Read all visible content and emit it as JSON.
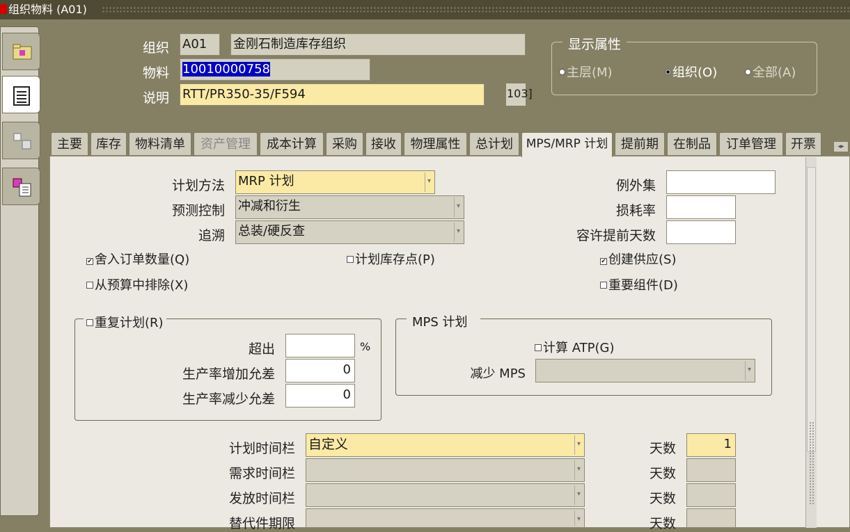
{
  "window": {
    "title": "组织物料 (A01)"
  },
  "header": {
    "org_label": "组织",
    "org_code": "A01",
    "org_name": "金刚石制造库存组织",
    "item_label": "物料",
    "item_value": "10010000758",
    "desc_label": "说明",
    "desc_value": "RTT/PR350-35/F594",
    "desc_extra": "103]"
  },
  "display_attrs": {
    "title": "显示属性",
    "options": [
      {
        "label": "主层(M)",
        "selected": false
      },
      {
        "label": "组织(O)",
        "selected": true
      },
      {
        "label": "全部(A)",
        "selected": false
      }
    ]
  },
  "tabs": [
    {
      "label": "主要",
      "enabled": true
    },
    {
      "label": "库存",
      "enabled": true
    },
    {
      "label": "物料清单",
      "enabled": true
    },
    {
      "label": "资产管理",
      "enabled": false
    },
    {
      "label": "成本计算",
      "enabled": true
    },
    {
      "label": "采购",
      "enabled": true
    },
    {
      "label": "接收",
      "enabled": true
    },
    {
      "label": "物理属性",
      "enabled": true
    },
    {
      "label": "总计划",
      "enabled": true
    },
    {
      "label": "MPS/MRP 计划",
      "enabled": true,
      "active": true
    },
    {
      "label": "提前期",
      "enabled": true
    },
    {
      "label": "在制品",
      "enabled": true
    },
    {
      "label": "订单管理",
      "enabled": true
    },
    {
      "label": "开票",
      "enabled": true
    }
  ],
  "planning": {
    "method_label": "计划方法",
    "method_value": "MRP 计划",
    "forecast_label": "预测控制",
    "forecast_value": "冲减和衍生",
    "pegging_label": "追溯",
    "pegging_value": "总装/硬反查",
    "exception_label": "例外集",
    "exception_value": "",
    "shrinkage_label": "损耗率",
    "shrinkage_value": "",
    "acceptable_early_label": "容许提前天数",
    "acceptable_early_value": ""
  },
  "checkboxes": {
    "round_order": {
      "label": "舍入订单数量(Q)",
      "checked": true
    },
    "exclude_budget": {
      "label": "从预算中排除(X)",
      "checked": false
    },
    "planned_inventory": {
      "label": "计划库存点(P)",
      "checked": false
    },
    "create_supply": {
      "label": "创建供应(S)",
      "checked": true
    },
    "critical_component": {
      "label": "重要组件(D)",
      "checked": false
    }
  },
  "repetitive": {
    "title": "重复计划(R)",
    "checked": false,
    "overrun_label": "超出",
    "overrun_value": "",
    "overrun_unit": "%",
    "rate_increase_label": "生产率增加允差",
    "rate_increase_value": "0",
    "rate_decrease_label": "生产率减少允差",
    "rate_decrease_value": "0"
  },
  "mps": {
    "title": "MPS 计划",
    "calc_atp_label": "计算 ATP(G)",
    "calc_atp_checked": false,
    "reduce_label": "减少 MPS",
    "reduce_value": ""
  },
  "time_fences": {
    "rows": [
      {
        "label": "计划时间栏",
        "value": "自定义",
        "days_label": "天数",
        "days": "1",
        "editable": true
      },
      {
        "label": "需求时间栏",
        "value": "",
        "days_label": "天数",
        "days": "",
        "editable": false
      },
      {
        "label": "发放时间栏",
        "value": "",
        "days_label": "天数",
        "days": "",
        "editable": false
      },
      {
        "label": "替代件期限",
        "value": "",
        "days_label": "天数",
        "days": "",
        "editable": false
      }
    ]
  }
}
